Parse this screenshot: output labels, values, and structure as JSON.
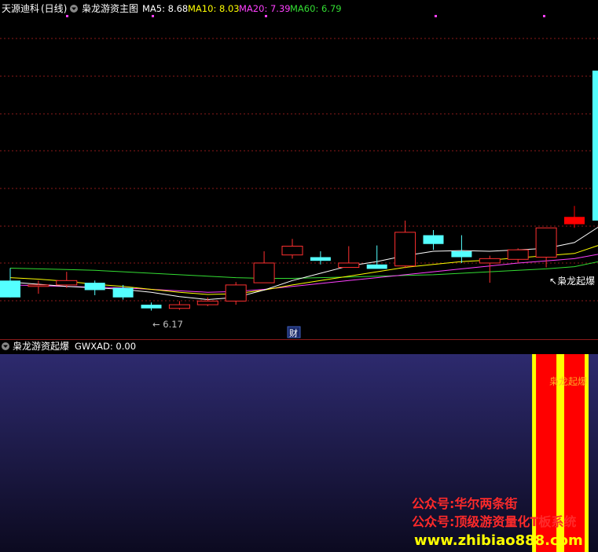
{
  "main_panel": {
    "stock_name": "天源迪科",
    "period": "(日线)",
    "indicator_name": "枭龙游资主图",
    "ma_readouts": [
      {
        "label": "MA5",
        "value": "8.68",
        "color": "#ffffff"
      },
      {
        "label": "MA10",
        "value": "8.03",
        "color": "#ffff00"
      },
      {
        "label": "MA20",
        "value": "7.39",
        "color": "#ff40ff"
      },
      {
        "label": "MA60",
        "value": "6.79",
        "color": "#33dd33"
      }
    ],
    "low_marker": "6.17",
    "cai_badge": "财",
    "signal_label": "枭龙起爆"
  },
  "sub_panel": {
    "indicator_name": "枭龙游资起爆",
    "readout_label": "GWXAD",
    "readout_value": "0.00",
    "signal_label": "枭龙起爆"
  },
  "watermarks": [
    "公众号:华尔两条街",
    "公众号:顶级游资量化T板系统",
    "www.zhibiao888.com"
  ],
  "colors": {
    "up": "#ff3030",
    "down": "#54ffff",
    "ma5": "#ffffff",
    "ma10": "#ffff00",
    "ma20": "#ff40ff",
    "ma60": "#33dd33",
    "grid": "#8b1a1a",
    "signal_red": "#ff0000",
    "signal_yellow": "#ffff00",
    "watermark_red": "#ff2a2a",
    "watermark_yellow": "#ffff00"
  },
  "chart_data": [
    {
      "type": "candlestick",
      "title": "枭龙游资主图",
      "ylim": [
        5.8,
        10.2
      ],
      "grid": true,
      "candles": [
        {
          "o": 6.58,
          "h": 6.75,
          "l": 6.35,
          "c": 6.35
        },
        {
          "o": 6.5,
          "h": 6.58,
          "l": 6.4,
          "c": 6.52
        },
        {
          "o": 6.52,
          "h": 6.7,
          "l": 6.48,
          "c": 6.58
        },
        {
          "o": 6.55,
          "h": 6.58,
          "l": 6.38,
          "c": 6.45
        },
        {
          "o": 6.48,
          "h": 6.52,
          "l": 6.32,
          "c": 6.35
        },
        {
          "o": 6.25,
          "h": 6.28,
          "l": 6.17,
          "c": 6.2
        },
        {
          "o": 6.2,
          "h": 6.3,
          "l": 6.18,
          "c": 6.25
        },
        {
          "o": 6.25,
          "h": 6.35,
          "l": 6.23,
          "c": 6.3
        },
        {
          "o": 6.3,
          "h": 6.56,
          "l": 6.25,
          "c": 6.52
        },
        {
          "o": 6.55,
          "h": 6.98,
          "l": 6.55,
          "c": 6.82
        },
        {
          "o": 6.93,
          "h": 7.15,
          "l": 6.88,
          "c": 7.05
        },
        {
          "o": 6.9,
          "h": 6.98,
          "l": 6.8,
          "c": 6.85
        },
        {
          "o": 6.76,
          "h": 7.05,
          "l": 6.76,
          "c": 6.82
        },
        {
          "o": 6.8,
          "h": 7.06,
          "l": 6.75,
          "c": 6.74
        },
        {
          "o": 6.78,
          "h": 7.4,
          "l": 6.75,
          "c": 7.24
        },
        {
          "o": 7.2,
          "h": 7.27,
          "l": 7.0,
          "c": 7.08
        },
        {
          "o": 6.98,
          "h": 7.2,
          "l": 6.82,
          "c": 6.9
        },
        {
          "o": 6.82,
          "h": 6.92,
          "l": 6.55,
          "c": 6.88
        },
        {
          "o": 6.87,
          "h": 7.02,
          "l": 6.82,
          "c": 7.0
        },
        {
          "o": 6.9,
          "h": 7.3,
          "l": 6.76,
          "c": 7.3
        },
        {
          "o": 7.45,
          "h": 7.6,
          "l": 7.3,
          "c": 7.35
        },
        {
          "o": 9.45,
          "h": 9.5,
          "l": 7.05,
          "c": 7.4
        }
      ],
      "ma5": [
        6.56,
        6.53,
        6.5,
        6.48,
        6.46,
        6.42,
        6.36,
        6.32,
        6.35,
        6.45,
        6.58,
        6.68,
        6.78,
        6.84,
        6.92,
        6.98,
        6.99,
        6.98,
        7.0,
        7.02,
        7.1,
        7.35
      ],
      "ma10": [
        6.62,
        6.6,
        6.57,
        6.53,
        6.5,
        6.46,
        6.42,
        6.39,
        6.4,
        6.45,
        6.52,
        6.58,
        6.64,
        6.7,
        6.76,
        6.8,
        6.84,
        6.86,
        6.89,
        6.92,
        6.95,
        7.08
      ],
      "ma20": [
        6.52,
        6.51,
        6.5,
        6.49,
        6.48,
        6.46,
        6.44,
        6.42,
        6.43,
        6.46,
        6.5,
        6.54,
        6.58,
        6.62,
        6.66,
        6.7,
        6.74,
        6.78,
        6.82,
        6.85,
        6.88,
        6.95
      ],
      "ma60": [
        6.75,
        6.74,
        6.73,
        6.72,
        6.7,
        6.68,
        6.66,
        6.64,
        6.62,
        6.61,
        6.61,
        6.62,
        6.63,
        6.64,
        6.65,
        6.66,
        6.68,
        6.7,
        6.72,
        6.74,
        6.77,
        6.85
      ]
    },
    {
      "type": "bar",
      "title": "枭龙游资起爆",
      "series": [
        {
          "name": "GWXAD",
          "values": [
            0,
            0,
            0,
            0,
            0,
            0,
            0,
            0,
            0,
            0,
            0,
            0,
            0,
            0,
            0,
            0,
            0,
            0,
            0,
            1,
            1,
            0
          ]
        }
      ]
    }
  ]
}
